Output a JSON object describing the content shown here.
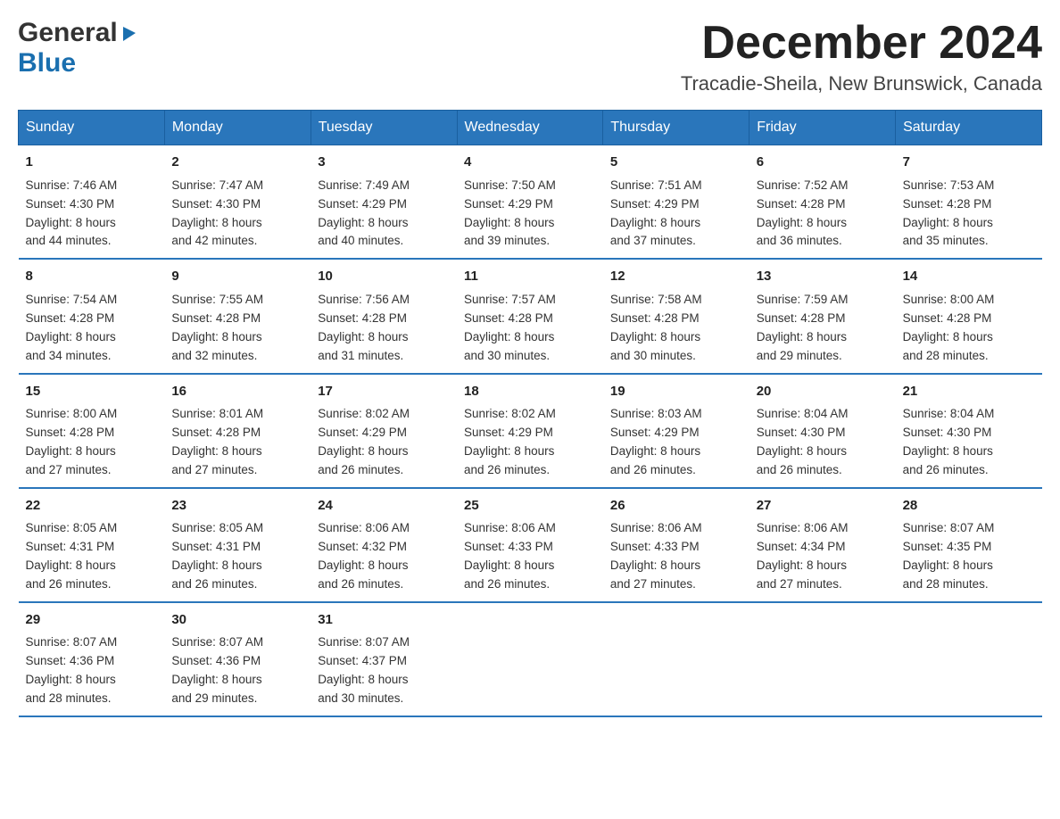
{
  "header": {
    "month_title": "December 2024",
    "location": "Tracadie-Sheila, New Brunswick, Canada",
    "logo_general": "General",
    "logo_blue": "Blue"
  },
  "columns": [
    "Sunday",
    "Monday",
    "Tuesday",
    "Wednesday",
    "Thursday",
    "Friday",
    "Saturday"
  ],
  "weeks": [
    [
      {
        "day": "1",
        "sunrise": "Sunrise: 7:46 AM",
        "sunset": "Sunset: 4:30 PM",
        "daylight": "Daylight: 8 hours",
        "daylight2": "and 44 minutes."
      },
      {
        "day": "2",
        "sunrise": "Sunrise: 7:47 AM",
        "sunset": "Sunset: 4:30 PM",
        "daylight": "Daylight: 8 hours",
        "daylight2": "and 42 minutes."
      },
      {
        "day": "3",
        "sunrise": "Sunrise: 7:49 AM",
        "sunset": "Sunset: 4:29 PM",
        "daylight": "Daylight: 8 hours",
        "daylight2": "and 40 minutes."
      },
      {
        "day": "4",
        "sunrise": "Sunrise: 7:50 AM",
        "sunset": "Sunset: 4:29 PM",
        "daylight": "Daylight: 8 hours",
        "daylight2": "and 39 minutes."
      },
      {
        "day": "5",
        "sunrise": "Sunrise: 7:51 AM",
        "sunset": "Sunset: 4:29 PM",
        "daylight": "Daylight: 8 hours",
        "daylight2": "and 37 minutes."
      },
      {
        "day": "6",
        "sunrise": "Sunrise: 7:52 AM",
        "sunset": "Sunset: 4:28 PM",
        "daylight": "Daylight: 8 hours",
        "daylight2": "and 36 minutes."
      },
      {
        "day": "7",
        "sunrise": "Sunrise: 7:53 AM",
        "sunset": "Sunset: 4:28 PM",
        "daylight": "Daylight: 8 hours",
        "daylight2": "and 35 minutes."
      }
    ],
    [
      {
        "day": "8",
        "sunrise": "Sunrise: 7:54 AM",
        "sunset": "Sunset: 4:28 PM",
        "daylight": "Daylight: 8 hours",
        "daylight2": "and 34 minutes."
      },
      {
        "day": "9",
        "sunrise": "Sunrise: 7:55 AM",
        "sunset": "Sunset: 4:28 PM",
        "daylight": "Daylight: 8 hours",
        "daylight2": "and 32 minutes."
      },
      {
        "day": "10",
        "sunrise": "Sunrise: 7:56 AM",
        "sunset": "Sunset: 4:28 PM",
        "daylight": "Daylight: 8 hours",
        "daylight2": "and 31 minutes."
      },
      {
        "day": "11",
        "sunrise": "Sunrise: 7:57 AM",
        "sunset": "Sunset: 4:28 PM",
        "daylight": "Daylight: 8 hours",
        "daylight2": "and 30 minutes."
      },
      {
        "day": "12",
        "sunrise": "Sunrise: 7:58 AM",
        "sunset": "Sunset: 4:28 PM",
        "daylight": "Daylight: 8 hours",
        "daylight2": "and 30 minutes."
      },
      {
        "day": "13",
        "sunrise": "Sunrise: 7:59 AM",
        "sunset": "Sunset: 4:28 PM",
        "daylight": "Daylight: 8 hours",
        "daylight2": "and 29 minutes."
      },
      {
        "day": "14",
        "sunrise": "Sunrise: 8:00 AM",
        "sunset": "Sunset: 4:28 PM",
        "daylight": "Daylight: 8 hours",
        "daylight2": "and 28 minutes."
      }
    ],
    [
      {
        "day": "15",
        "sunrise": "Sunrise: 8:00 AM",
        "sunset": "Sunset: 4:28 PM",
        "daylight": "Daylight: 8 hours",
        "daylight2": "and 27 minutes."
      },
      {
        "day": "16",
        "sunrise": "Sunrise: 8:01 AM",
        "sunset": "Sunset: 4:28 PM",
        "daylight": "Daylight: 8 hours",
        "daylight2": "and 27 minutes."
      },
      {
        "day": "17",
        "sunrise": "Sunrise: 8:02 AM",
        "sunset": "Sunset: 4:29 PM",
        "daylight": "Daylight: 8 hours",
        "daylight2": "and 26 minutes."
      },
      {
        "day": "18",
        "sunrise": "Sunrise: 8:02 AM",
        "sunset": "Sunset: 4:29 PM",
        "daylight": "Daylight: 8 hours",
        "daylight2": "and 26 minutes."
      },
      {
        "day": "19",
        "sunrise": "Sunrise: 8:03 AM",
        "sunset": "Sunset: 4:29 PM",
        "daylight": "Daylight: 8 hours",
        "daylight2": "and 26 minutes."
      },
      {
        "day": "20",
        "sunrise": "Sunrise: 8:04 AM",
        "sunset": "Sunset: 4:30 PM",
        "daylight": "Daylight: 8 hours",
        "daylight2": "and 26 minutes."
      },
      {
        "day": "21",
        "sunrise": "Sunrise: 8:04 AM",
        "sunset": "Sunset: 4:30 PM",
        "daylight": "Daylight: 8 hours",
        "daylight2": "and 26 minutes."
      }
    ],
    [
      {
        "day": "22",
        "sunrise": "Sunrise: 8:05 AM",
        "sunset": "Sunset: 4:31 PM",
        "daylight": "Daylight: 8 hours",
        "daylight2": "and 26 minutes."
      },
      {
        "day": "23",
        "sunrise": "Sunrise: 8:05 AM",
        "sunset": "Sunset: 4:31 PM",
        "daylight": "Daylight: 8 hours",
        "daylight2": "and 26 minutes."
      },
      {
        "day": "24",
        "sunrise": "Sunrise: 8:06 AM",
        "sunset": "Sunset: 4:32 PM",
        "daylight": "Daylight: 8 hours",
        "daylight2": "and 26 minutes."
      },
      {
        "day": "25",
        "sunrise": "Sunrise: 8:06 AM",
        "sunset": "Sunset: 4:33 PM",
        "daylight": "Daylight: 8 hours",
        "daylight2": "and 26 minutes."
      },
      {
        "day": "26",
        "sunrise": "Sunrise: 8:06 AM",
        "sunset": "Sunset: 4:33 PM",
        "daylight": "Daylight: 8 hours",
        "daylight2": "and 27 minutes."
      },
      {
        "day": "27",
        "sunrise": "Sunrise: 8:06 AM",
        "sunset": "Sunset: 4:34 PM",
        "daylight": "Daylight: 8 hours",
        "daylight2": "and 27 minutes."
      },
      {
        "day": "28",
        "sunrise": "Sunrise: 8:07 AM",
        "sunset": "Sunset: 4:35 PM",
        "daylight": "Daylight: 8 hours",
        "daylight2": "and 28 minutes."
      }
    ],
    [
      {
        "day": "29",
        "sunrise": "Sunrise: 8:07 AM",
        "sunset": "Sunset: 4:36 PM",
        "daylight": "Daylight: 8 hours",
        "daylight2": "and 28 minutes."
      },
      {
        "day": "30",
        "sunrise": "Sunrise: 8:07 AM",
        "sunset": "Sunset: 4:36 PM",
        "daylight": "Daylight: 8 hours",
        "daylight2": "and 29 minutes."
      },
      {
        "day": "31",
        "sunrise": "Sunrise: 8:07 AM",
        "sunset": "Sunset: 4:37 PM",
        "daylight": "Daylight: 8 hours",
        "daylight2": "and 30 minutes."
      },
      null,
      null,
      null,
      null
    ]
  ]
}
